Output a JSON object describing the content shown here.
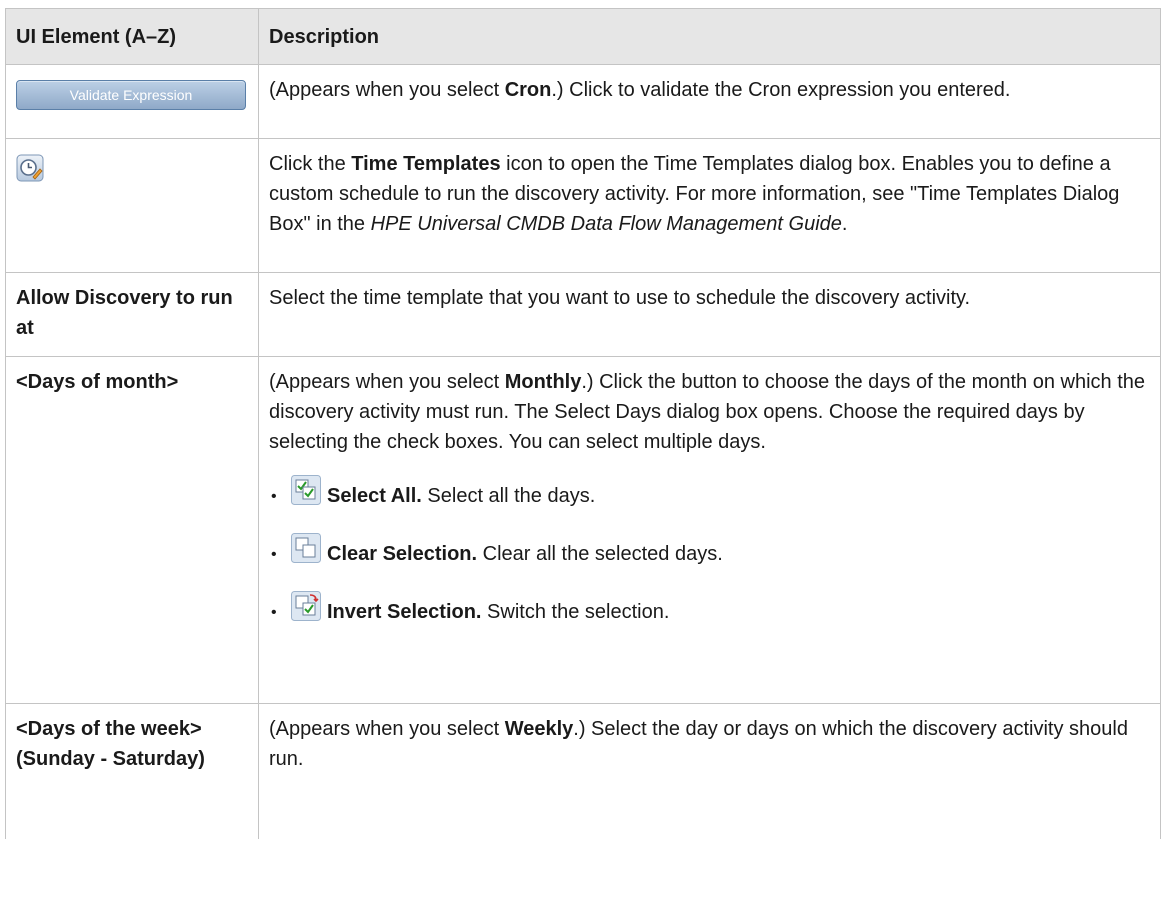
{
  "table": {
    "header": {
      "col1": "UI Element (A–Z)",
      "col2": "Description"
    },
    "rows": [
      {
        "button_label": "Validate Expression",
        "desc": {
          "t1": "(Appears when you select ",
          "b1": "Cron",
          "t2": ".) Click to validate the Cron expression you entered."
        }
      },
      {
        "icon": "time-templates-icon",
        "desc": {
          "t1": "Click the ",
          "b1": "Time Templates",
          "t2": " icon to open the Time Templates dialog box. Enables you to define a custom schedule to run the discovery activity. For more information, see \"Time Templates Dialog Box\" in the ",
          "i1": "HPE Universal CMDB Data Flow Management Guide",
          "t3": "."
        }
      },
      {
        "element": "Allow Discovery to run at",
        "desc": {
          "t1": "Select the time template that you want to use to schedule the discovery activity."
        }
      },
      {
        "element": "<Days of month>",
        "desc": {
          "t1": "(Appears when you select ",
          "b1": "Monthly",
          "t2": ".) Click the button to choose the days of the month on which the discovery activity must run. The Select Days dialog box opens. Choose the required days by selecting the check boxes. You can select multiple days."
        },
        "bullets": [
          {
            "icon": "select-all-icon",
            "label": "Select All.",
            "text": " Select all the days."
          },
          {
            "icon": "clear-selection-icon",
            "label": "Clear Selection.",
            "text": " Clear all the selected days."
          },
          {
            "icon": "invert-selection-icon",
            "label": "Invert Selection.",
            "text": " Switch the selection."
          }
        ]
      },
      {
        "element": "<Days of the week> (Sunday - Saturday)",
        "desc": {
          "t1": "(Appears when you select ",
          "b1": "Weekly",
          "t2": ".) Select the day or days on which the discovery activity should run."
        }
      }
    ]
  }
}
